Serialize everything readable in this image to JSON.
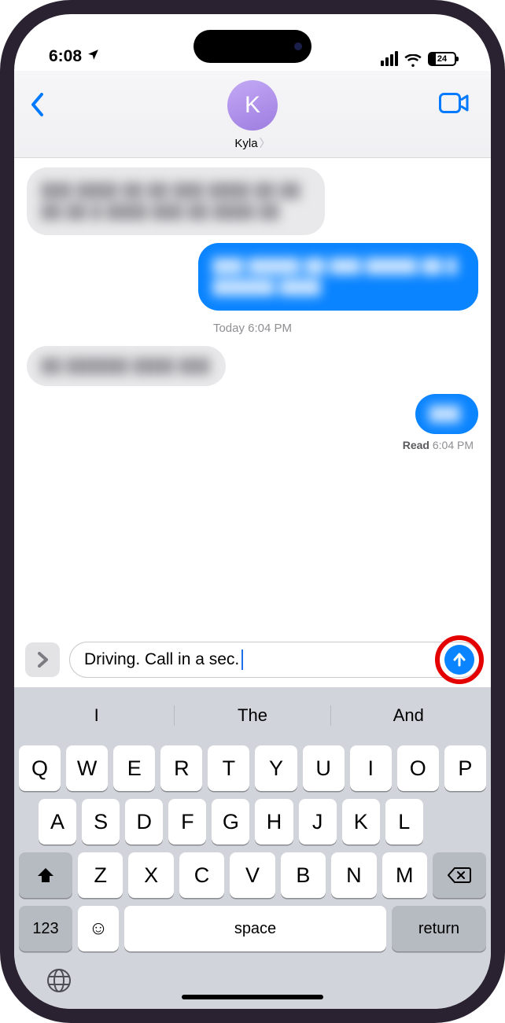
{
  "status": {
    "time": "6:08",
    "battery_percent": "24",
    "battery_fill_pct": 24
  },
  "header": {
    "contact_initial": "K",
    "contact_name": "Kyla"
  },
  "conversation": {
    "timestamp": "Today 6:04 PM",
    "read_label": "Read",
    "read_time": "6:04 PM",
    "bubble1_placeholder": "███ ████ ██ ██ ███ ████ ██ ████ ██ █ ████ ███ ██ ████ ██",
    "bubble2_placeholder": "███ █████ ██ ███ █████ ██ ███████ ████",
    "bubble3_placeholder": "██ ██████ ████ ███",
    "bubble4_placeholder": "███"
  },
  "input": {
    "text": "Driving. Call in a sec."
  },
  "keyboard": {
    "predictions": [
      "I",
      "The",
      "And"
    ],
    "row1": [
      "Q",
      "W",
      "E",
      "R",
      "T",
      "Y",
      "U",
      "I",
      "O",
      "P"
    ],
    "row2": [
      "A",
      "S",
      "D",
      "F",
      "G",
      "H",
      "J",
      "K",
      "L"
    ],
    "row3": [
      "Z",
      "X",
      "C",
      "V",
      "B",
      "N",
      "M"
    ],
    "sym_label": "123",
    "space_label": "space",
    "return_label": "return"
  }
}
